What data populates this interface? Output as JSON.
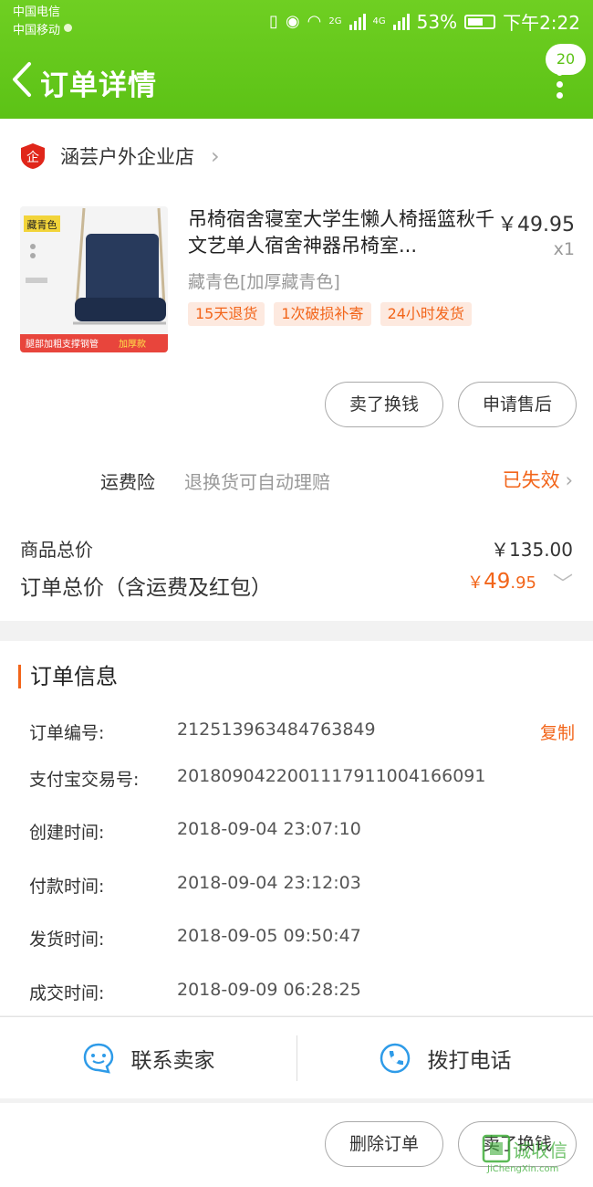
{
  "status_bar": {
    "carrier1": "中国电信",
    "carrier2": "中国移动",
    "net1": "2G",
    "net2": "4G",
    "battery": "53%",
    "time": "下午2:22"
  },
  "header": {
    "title": "订单详情",
    "badge": "20"
  },
  "shop": {
    "logo_text": "企",
    "name": "涵芸户外企业店"
  },
  "product": {
    "name": "吊椅宿舍寝室大学生懒人椅摇篮秋千文艺单人宿舍神器吊椅室...",
    "price": "￥49.95",
    "qty": "x1",
    "sku": "藏青色[加厚藏青色]",
    "tags": [
      "15天退货",
      "1次破损补寄",
      "24小时发货"
    ],
    "image_label_top": "藏青色",
    "image_label_bottom": "腿部加粗支撑钢管",
    "image_label_bottom2": "加厚款"
  },
  "actions": {
    "sell_label": "卖了换钱",
    "after_sale_label": "申请售后"
  },
  "insurance": {
    "label": "运费险",
    "desc": "退换货可自动理赔",
    "status": "已失效"
  },
  "summary": {
    "goods_total_label": "商品总价",
    "goods_total": "￥135.00",
    "order_total_label": "订单总价（含运费及红包）",
    "order_total_currency": "￥",
    "order_total_int": "49",
    "order_total_dec": ".95"
  },
  "order_info": {
    "title": "订单信息",
    "copy_label": "复制",
    "rows": [
      {
        "label": "订单编号:",
        "value": "212513963484763849"
      },
      {
        "label": "支付宝交易号:",
        "value": "2018090422001117911004166091"
      },
      {
        "label": "创建时间:",
        "value": "2018-09-04 23:07:10"
      },
      {
        "label": "付款时间:",
        "value": "2018-09-04 23:12:03"
      },
      {
        "label": "发货时间:",
        "value": "2018-09-05 09:50:47"
      },
      {
        "label": "成交时间:",
        "value": "2018-09-09 06:28:25"
      }
    ]
  },
  "contact": {
    "seller_label": "联系卖家",
    "phone_label": "拨打电话"
  },
  "bottom_bar": {
    "delete_label": "删除订单",
    "sell_label": "卖了换钱"
  },
  "watermark": {
    "text": "诚收信",
    "url": "JiChengXin.com"
  },
  "colors": {
    "brand_green": "#5cc216",
    "accent_orange": "#f2651a"
  }
}
